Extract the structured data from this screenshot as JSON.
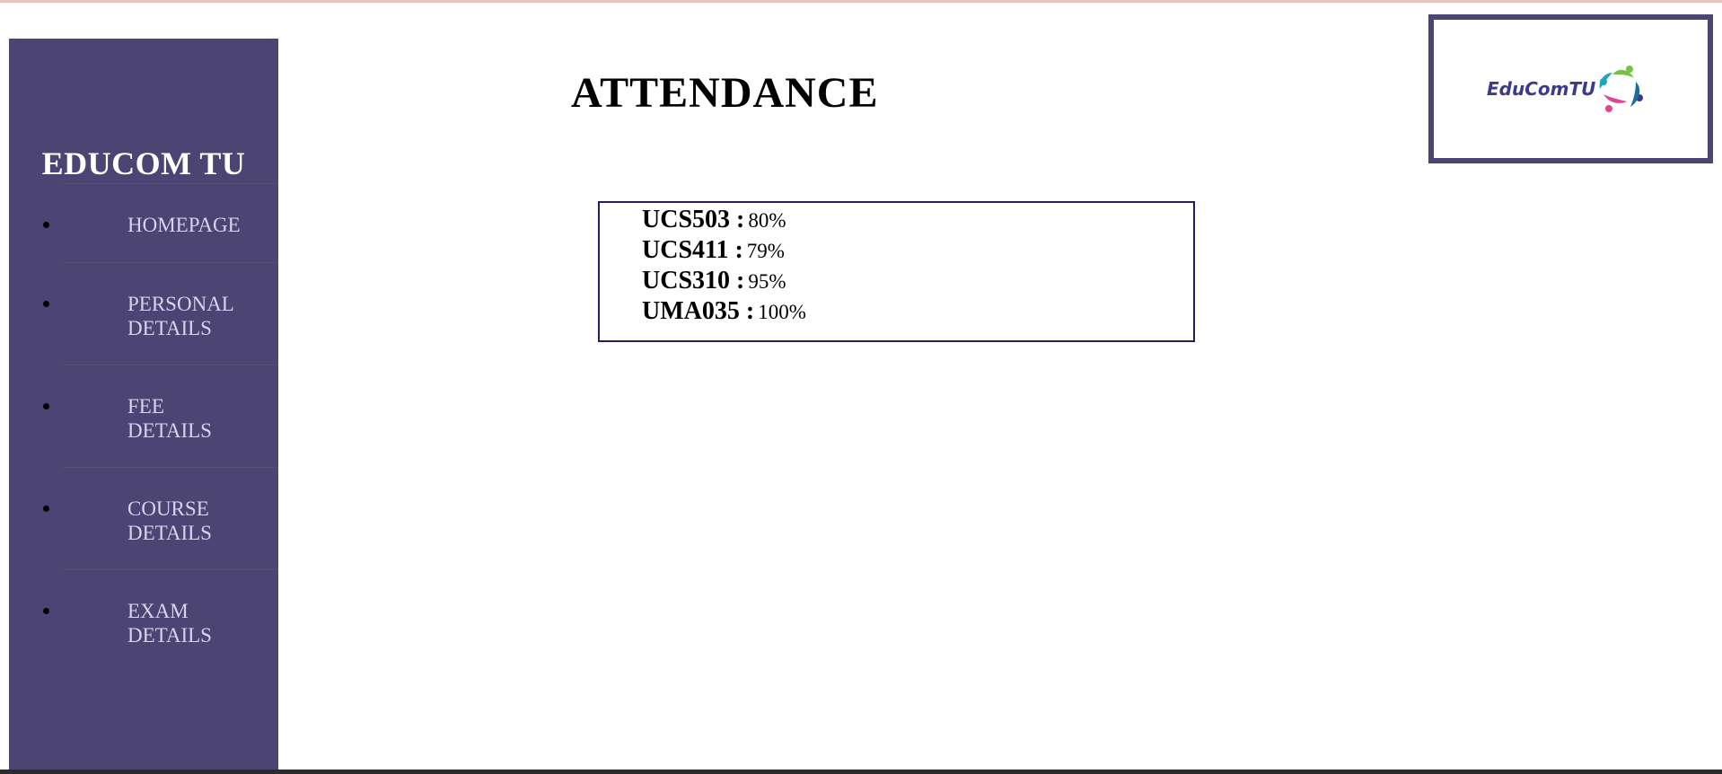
{
  "sidebar": {
    "brand": "EDUCOM TU",
    "items": [
      {
        "id": "homepage",
        "lines": [
          "HOMEPAGE"
        ]
      },
      {
        "id": "personal-details",
        "lines": [
          "PERSONAL",
          "DETAILS"
        ]
      },
      {
        "id": "fee-details",
        "lines": [
          "FEE",
          "DETAILS"
        ]
      },
      {
        "id": "course-details",
        "lines": [
          "COURSE",
          "DETAILS"
        ]
      },
      {
        "id": "exam-details",
        "lines": [
          "EXAM",
          "DETAILS"
        ]
      }
    ]
  },
  "main": {
    "title": "ATTENDANCE",
    "attendance": [
      {
        "code": "UCS503 :",
        "value": "80%"
      },
      {
        "code": "UCS411 :",
        "value": "79%"
      },
      {
        "code": "UCS310 :",
        "value": "95%"
      },
      {
        "code": "UMA035 :",
        "value": "100%"
      }
    ]
  },
  "logo": {
    "text": "EduComTU",
    "colors": [
      "#7ac143",
      "#1aa7b8",
      "#e0458f",
      "#3d3a8e"
    ]
  },
  "theme": {
    "sidebar_bg": "#4c4472",
    "box_border": "#2d1a5a"
  }
}
